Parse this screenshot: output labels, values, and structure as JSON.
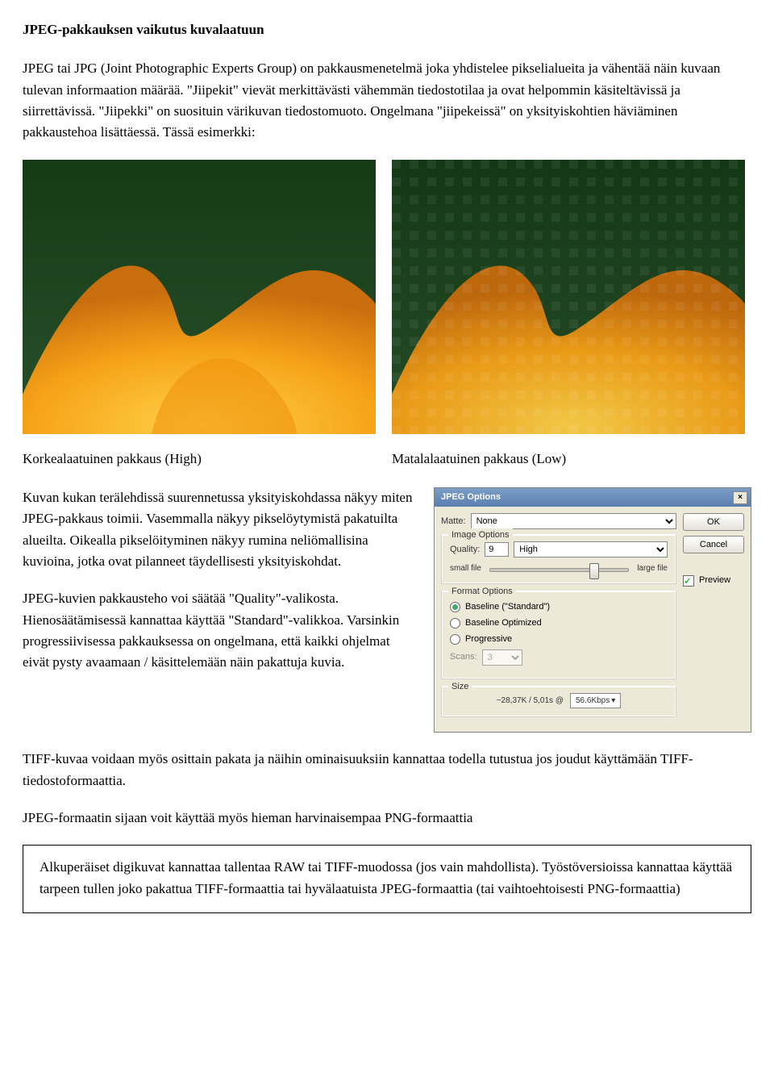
{
  "title": "JPEG-pakkauksen vaikutus kuvalaatuun",
  "intro": "JPEG tai JPG (Joint Photographic Experts Group) on pakkausmenetelmä joka yhdistelee pikselialueita ja vähentää näin kuvaan tulevan informaation määrää. \"Jiipekit\" vievät merkittävästi vähemmän tiedostotilaa ja ovat helpommin käsiteltävissä ja siirrettävissä. \"Jiipekki\" on suosituin värikuvan tiedostomuoto. Ongelmana \"jiipekeissä\" on yksityiskohtien häviäminen pakkaustehoa lisättäessä. Tässä esimerkki:",
  "captions": {
    "high": "Korkealaatuinen pakkaus (High)",
    "low": "Matalalaatuinen pakkaus (Low)"
  },
  "para2a": "Kuvan kukan terälehdissä suurennetussa yksityiskohdassa näkyy miten JPEG-pakkaus toimii. Vasemmalla näkyy pikselöytymistä pakatuilta alueilta. Oikealla pikselöityminen näkyy rumina neliömallisina kuvioina, jotka ovat pilanneet täydellisesti yksityiskohdat.",
  "para2b": "JPEG-kuvien pakkausteho voi säätää \"Quality\"-valikosta. Hienosäätämisessä kannattaa käyttää \"Standard\"-valikkoa. Varsinkin progressiivisessa pakkauksessa on ongelmana, että kaikki ohjelmat eivät pysty avaamaan / käsittelemään näin pakattuja kuvia.",
  "para3": "TIFF-kuvaa voidaan myös osittain pakata ja näihin ominaisuuksiin kannattaa todella tutustua jos joudut käyttämään TIFF-tiedostoformaattia.",
  "para4": "JPEG-formaatin sijaan voit käyttää myös hieman harvinaisempaa PNG-formaattia",
  "tip": "Alkuperäiset digikuvat kannattaa tallentaa RAW tai TIFF-muodossa (jos vain mahdollista). Työstöversioissa kannattaa käyttää tarpeen tullen joko pakattua TIFF-formaattia tai hyvälaatuista JPEG-formaattia (tai vaihtoehtoisesti PNG-formaattia)",
  "dialog": {
    "title": "JPEG Options",
    "ok": "OK",
    "cancel": "Cancel",
    "preview": "Preview",
    "matte_label": "Matte:",
    "matte_value": "None",
    "image_options_legend": "Image Options",
    "quality_label": "Quality:",
    "quality_value": "9",
    "quality_preset": "High",
    "small_file": "small file",
    "large_file": "large file",
    "format_options_legend": "Format Options",
    "baseline_standard": "Baseline (\"Standard\")",
    "baseline_optimized": "Baseline Optimized",
    "progressive": "Progressive",
    "scans_label": "Scans:",
    "scans_value": "3",
    "size_legend": "Size",
    "size_text": "~28,37K / 5,01s @",
    "size_rate": "56.6Kbps"
  }
}
